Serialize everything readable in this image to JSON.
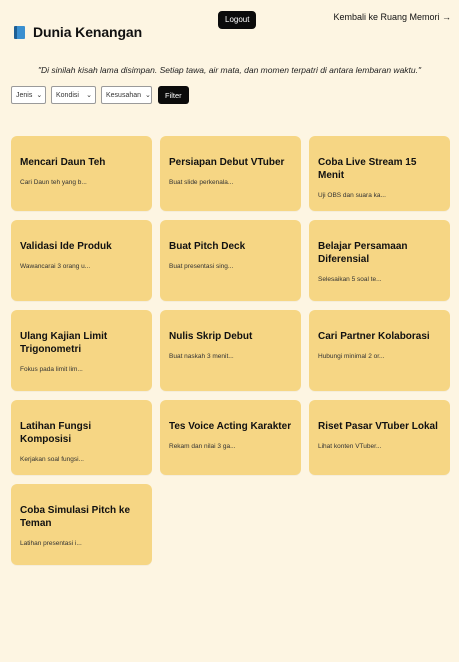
{
  "header": {
    "title": "Dunia Kenangan",
    "logout_label": "Logout",
    "back_label": "Kembali ke Ruang Memori →"
  },
  "quote": "\"Di sinilah kisah lama disimpan. Setiap tawa, air mata, dan momen terpatri di antara lembaran waktu.\"",
  "filters": {
    "jenis": "Jenis",
    "kondisi": "Kondisi",
    "kesusahan": "Kesusahan",
    "filter_label": "Filter"
  },
  "cards": [
    {
      "title": "Mencari Daun Teh",
      "desc": "Cari Daun teh yang b..."
    },
    {
      "title": "Persiapan Debut VTuber",
      "desc": "Buat slide perkenala..."
    },
    {
      "title": "Coba Live Stream 15 Menit",
      "desc": "Uji OBS dan suara ka..."
    },
    {
      "title": "Validasi Ide Produk",
      "desc": "Wawancarai 3 orang u..."
    },
    {
      "title": "Buat Pitch Deck",
      "desc": "Buat presentasi sing..."
    },
    {
      "title": "Belajar Persamaan Diferensial",
      "desc": "Selesaikan 5 soal te..."
    },
    {
      "title": "Ulang Kajian Limit Trigonometri",
      "desc": "Fokus pada limit lim..."
    },
    {
      "title": "Nulis Skrip Debut",
      "desc": "Buat naskah 3 menit..."
    },
    {
      "title": "Cari Partner Kolaborasi",
      "desc": "Hubungi minimal 2 or..."
    },
    {
      "title": "Latihan Fungsi Komposisi",
      "desc": "Kerjakan soal fungsi..."
    },
    {
      "title": "Tes Voice Acting Karakter",
      "desc": "Rekam dan nilai 3 ga..."
    },
    {
      "title": "Riset Pasar VTuber Lokal",
      "desc": "Lihat konten VTuber..."
    },
    {
      "title": "Coba Simulasi Pitch ke Teman",
      "desc": "Latihan presentasi i..."
    }
  ],
  "colors": {
    "background": "#fdf5e2",
    "card": "#f6d684",
    "button": "#0b0b0b"
  }
}
